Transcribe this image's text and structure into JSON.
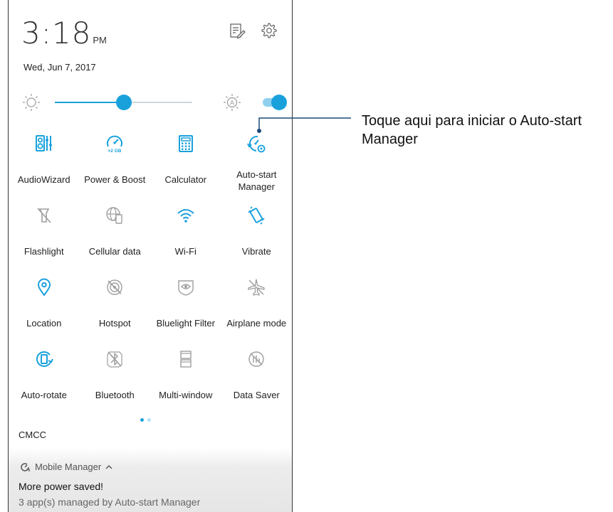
{
  "status": {
    "time": "3:18",
    "ampm": "PM",
    "date": "Wed, Jun 7, 2017"
  },
  "header_icons": [
    "edit-icon",
    "gear-icon"
  ],
  "brightness": {
    "level": 0.5,
    "auto_enabled": true,
    "auto_label": "A"
  },
  "tiles": [
    [
      {
        "label": "AudioWizard",
        "icon": "audiowizard-icon",
        "active": true
      },
      {
        "label": "Power & Boost",
        "icon": "power-boost-icon",
        "active": true,
        "badge": ">2 GB"
      },
      {
        "label": "Calculator",
        "icon": "calculator-icon",
        "active": true
      },
      {
        "label": "Auto-start Manager",
        "icon": "auto-start-manager-icon",
        "active": true
      }
    ],
    [
      {
        "label": "Flashlight",
        "icon": "flashlight-icon",
        "active": false
      },
      {
        "label": "Cellular data",
        "icon": "cellular-data-icon",
        "active": false
      },
      {
        "label": "Wi-Fi",
        "icon": "wifi-icon",
        "active": true
      },
      {
        "label": "Vibrate",
        "icon": "vibrate-icon",
        "active": true
      }
    ],
    [
      {
        "label": "Location",
        "icon": "location-icon",
        "active": true
      },
      {
        "label": "Hotspot",
        "icon": "hotspot-icon",
        "active": false
      },
      {
        "label": "Bluelight Filter",
        "icon": "bluelight-filter-icon",
        "active": false
      },
      {
        "label": "Airplane mode",
        "icon": "airplane-icon",
        "active": false
      }
    ],
    [
      {
        "label": "Auto-rotate",
        "icon": "auto-rotate-icon",
        "active": true
      },
      {
        "label": "Bluetooth",
        "icon": "bluetooth-icon",
        "active": false
      },
      {
        "label": "Multi-window",
        "icon": "multi-window-icon",
        "active": false
      },
      {
        "label": "Data Saver",
        "icon": "data-saver-icon",
        "active": false
      }
    ]
  ],
  "page_indicator": {
    "current": 1,
    "total": 2
  },
  "carrier": "CMCC",
  "notification": {
    "app": "Mobile Manager",
    "expand_icon": "chevron-up-icon",
    "title": "More power saved!",
    "body": "3 app(s) managed by Auto-start Manager"
  },
  "callout": {
    "text": "Toque aqui para iniciar o Auto-start Manager"
  },
  "colors": {
    "accent": "#1aa1dc",
    "accent_light": "#8fd0ee",
    "inactive": "#9e9e9e",
    "slider_track": "#cfd8dc",
    "dot_inactive": "#b3e0f2",
    "callout_line": "#1a4a7a"
  }
}
